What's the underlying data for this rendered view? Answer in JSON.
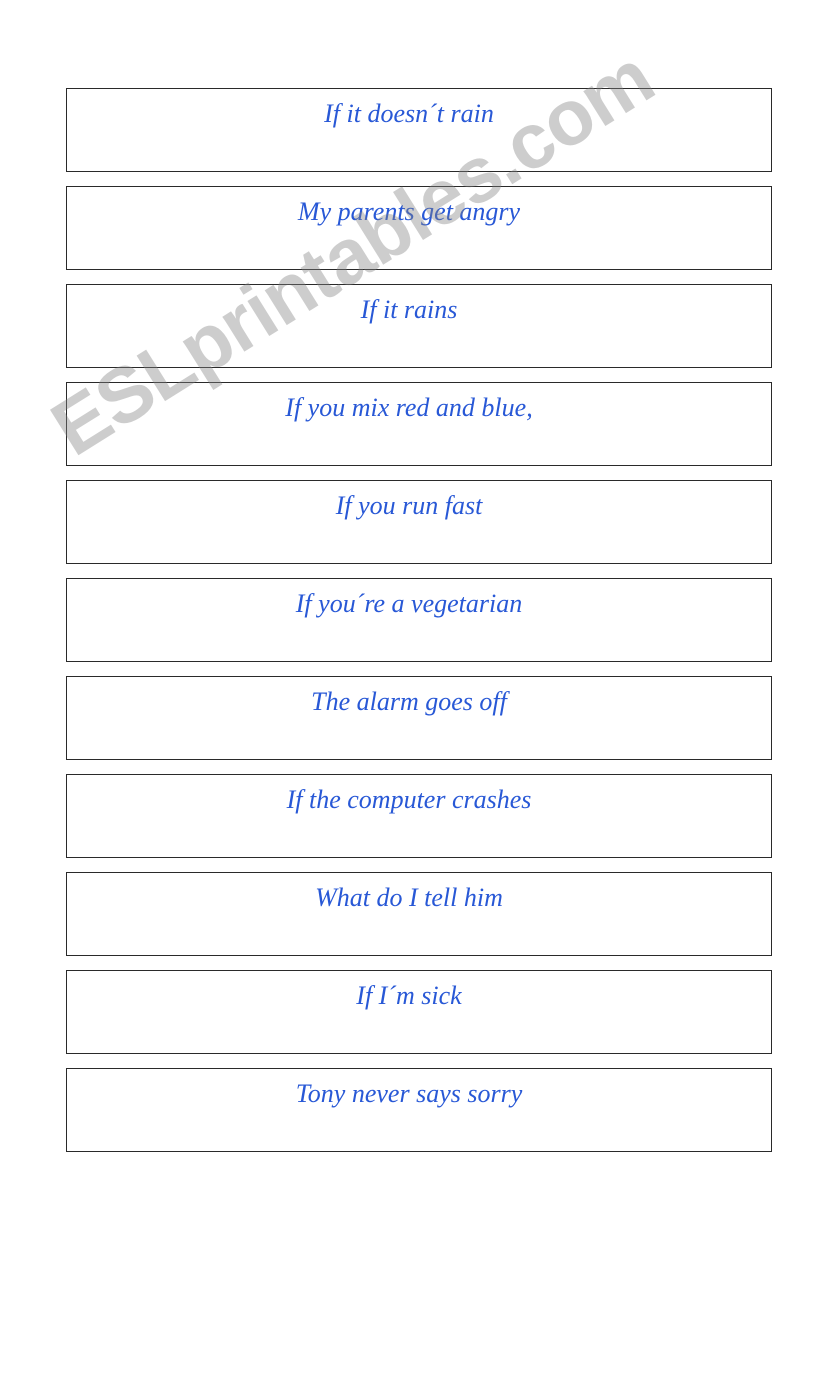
{
  "items": [
    "If it doesn´t rain",
    "My parents get angry",
    "If it rains",
    "If you mix red and blue,",
    "If you run fast",
    "If you´re a vegetarian",
    "The alarm goes off",
    "If the computer crashes",
    "What do I tell him",
    "If I´m sick",
    "Tony never says sorry"
  ],
  "watermark": "ESLprintables.com"
}
